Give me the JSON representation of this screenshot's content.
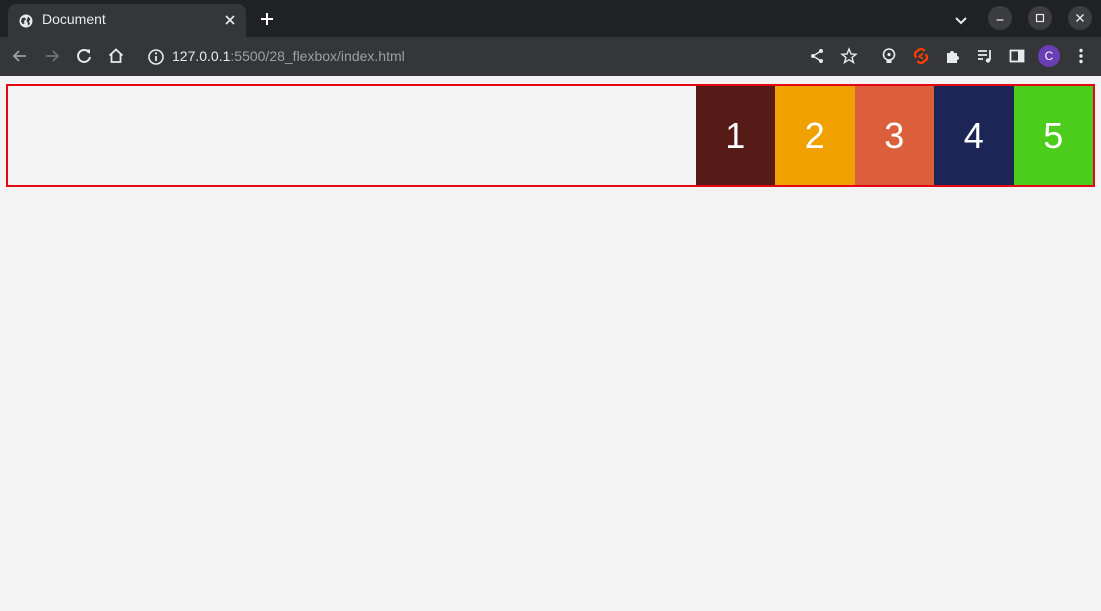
{
  "browser": {
    "tab": {
      "title": "Document",
      "favicon": "globe-icon",
      "close_icon": "close-icon"
    },
    "new_tab_icon": "plus-icon",
    "url_host": "127.0.0.1",
    "url_rest": ":5500/28_flexbox/index.html",
    "profile_initial": "C",
    "profile_color": "#6a3fb6"
  },
  "page": {
    "container_border_color": "#e30613",
    "items": [
      {
        "label": "1",
        "color": "#561b16"
      },
      {
        "label": "2",
        "color": "#f1a001"
      },
      {
        "label": "3",
        "color": "#dc5f3b"
      },
      {
        "label": "4",
        "color": "#1c2656"
      },
      {
        "label": "5",
        "color": "#4ccd1c"
      }
    ]
  }
}
